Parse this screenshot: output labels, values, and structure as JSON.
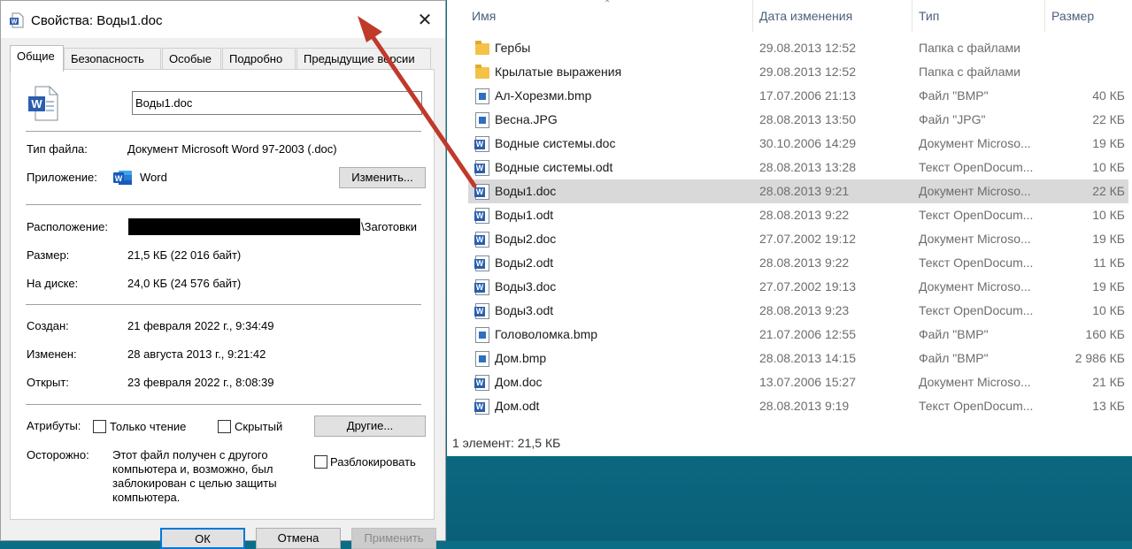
{
  "explorer": {
    "columns": {
      "name": "Имя",
      "date": "Дата изменения",
      "type": "Тип",
      "size": "Размер"
    },
    "files": [
      {
        "icon": "folder-icon",
        "name": "Гербы",
        "date": "29.08.2013 12:52",
        "type": "Папка с файлами",
        "size": ""
      },
      {
        "icon": "folder-icon",
        "name": "Крылатые выражения",
        "date": "29.08.2013 12:52",
        "type": "Папка с файлами",
        "size": ""
      },
      {
        "icon": "image-file-icon",
        "name": "Ал-Хорезми.bmp",
        "date": "17.07.2006 21:13",
        "type": "Файл \"BMP\"",
        "size": "40 КБ"
      },
      {
        "icon": "image-file-icon",
        "name": "Весна.JPG",
        "date": "28.08.2013 13:50",
        "type": "Файл \"JPG\"",
        "size": "22 КБ"
      },
      {
        "icon": "word-doc-icon",
        "name": "Водные системы.doc",
        "date": "30.10.2006 14:29",
        "type": "Документ Microso...",
        "size": "19 КБ"
      },
      {
        "icon": "word-doc-icon",
        "name": "Водные системы.odt",
        "date": "28.08.2013 13:28",
        "type": "Текст OpenDocum...",
        "size": "10 КБ"
      },
      {
        "icon": "word-doc-icon",
        "name": "Воды1.doc",
        "date": "28.08.2013 9:21",
        "type": "Документ Microso...",
        "size": "22 КБ",
        "selected": true
      },
      {
        "icon": "word-doc-icon",
        "name": "Воды1.odt",
        "date": "28.08.2013 9:22",
        "type": "Текст OpenDocum...",
        "size": "10 КБ"
      },
      {
        "icon": "word-doc-icon",
        "name": "Воды2.doc",
        "date": "27.07.2002 19:12",
        "type": "Документ Microso...",
        "size": "19 КБ"
      },
      {
        "icon": "word-doc-icon",
        "name": "Воды2.odt",
        "date": "28.08.2013 9:22",
        "type": "Текст OpenDocum...",
        "size": "11 КБ"
      },
      {
        "icon": "word-doc-icon",
        "name": "Воды3.doc",
        "date": "27.07.2002 19:13",
        "type": "Документ Microso...",
        "size": "19 КБ"
      },
      {
        "icon": "word-doc-icon",
        "name": "Воды3.odt",
        "date": "28.08.2013 9:23",
        "type": "Текст OpenDocum...",
        "size": "10 КБ"
      },
      {
        "icon": "image-file-icon",
        "name": "Головоломка.bmp",
        "date": "21.07.2006 12:55",
        "type": "Файл \"BMP\"",
        "size": "160 КБ"
      },
      {
        "icon": "image-file-icon",
        "name": "Дом.bmp",
        "date": "28.08.2013 14:15",
        "type": "Файл \"BMP\"",
        "size": "2 986 КБ"
      },
      {
        "icon": "word-doc-icon",
        "name": "Дом.doc",
        "date": "13.07.2006 15:27",
        "type": "Документ Microso...",
        "size": "21 КБ"
      },
      {
        "icon": "word-doc-icon",
        "name": "Дом.odt",
        "date": "28.08.2013 9:19",
        "type": "Текст OpenDocum...",
        "size": "13 КБ"
      }
    ],
    "status": "1 элемент: 21,5 КБ"
  },
  "dialog": {
    "title": "Свойства: Воды1.doc",
    "tabs": [
      "Общие",
      "Безопасность",
      "Особые",
      "Подробно",
      "Предыдущие версии"
    ],
    "file_name": "Воды1.doc",
    "labels": {
      "file_type": "Тип файла:",
      "app": "Приложение:",
      "location": "Расположение:",
      "size": "Размер:",
      "on_disk": "На диске:",
      "created": "Создан:",
      "modified": "Изменен:",
      "opened": "Открыт:",
      "attributes": "Атрибуты:",
      "caution": "Осторожно:"
    },
    "values": {
      "file_type": "Документ Microsoft Word 97-2003 (.doc)",
      "app": "Word",
      "location_tail": "\\Заготовки",
      "size": "21,5 КБ (22 016 байт)",
      "on_disk": "24,0 КБ (24 576 байт)",
      "created": "21 февраля 2022 г., 9:34:49",
      "modified": "28 августа 2013 г., 9:21:42",
      "opened": "23 февраля 2022 г., 8:08:39",
      "caution": "Этот файл получен с другого компьютера и, возможно, был заблокирован с целью защиты компьютера."
    },
    "buttons": {
      "change": "Изменить...",
      "other": "Другие...",
      "ok": "ОК",
      "cancel": "Отмена",
      "apply": "Применить"
    },
    "checkboxes": {
      "readonly": {
        "label": "Только чтение",
        "checked": false
      },
      "hidden": {
        "label": "Скрытый",
        "checked": false
      },
      "unblock": {
        "label": "Разблокировать",
        "checked": false
      }
    }
  },
  "colors": {
    "arrow": "#c0392b",
    "selection": "#d9d9d9",
    "desktop": "#0e7d93"
  }
}
